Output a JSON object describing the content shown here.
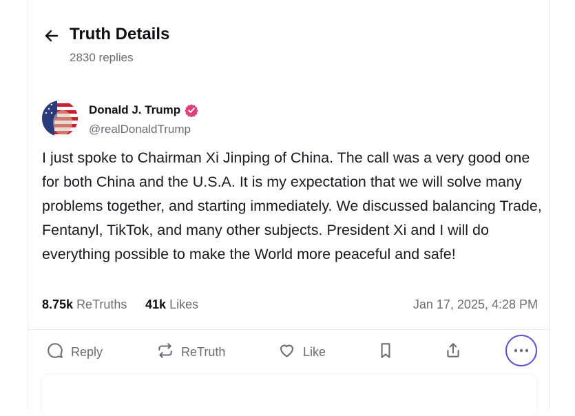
{
  "header": {
    "title": "Truth Details",
    "replies": "2830 replies"
  },
  "post": {
    "author_name": "Donald J. Trump",
    "handle": "@realDonaldTrump",
    "text": "I just spoke to Chairman Xi Jinping of China. The call was a very good one for both China and the U.S.A. It is my expectation that we will solve many problems together, and starting immediately. We discussed balancing Trade, Fentanyl, TikTok, and many other subjects. President Xi and I will do everything possible to make the World more peaceful and safe!",
    "retruths_count": "8.75k",
    "retruths_label": "ReTruths",
    "likes_count": "41k",
    "likes_label": "Likes",
    "date": "Jan 17, 2025, 4:28 PM"
  },
  "actions": {
    "reply": "Reply",
    "retruth": "ReTruth",
    "like": "Like"
  },
  "colors": {
    "accent": "#5b4fd6",
    "verified": "#e0407a",
    "muted": "#6b6b78"
  },
  "icons": [
    "arrow-left-icon",
    "verified-badge-icon",
    "reply-icon",
    "retruth-icon",
    "heart-icon",
    "bookmark-icon",
    "share-icon",
    "more-icon"
  ]
}
